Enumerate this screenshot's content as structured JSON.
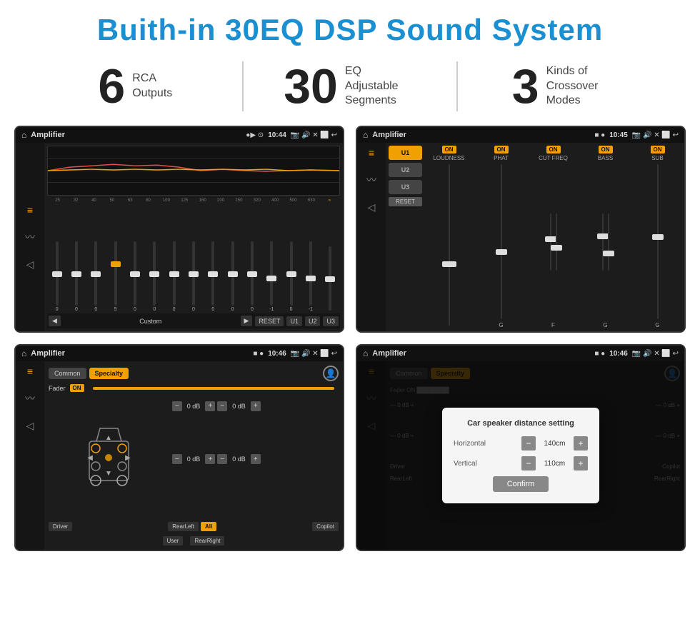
{
  "header": {
    "title": "Buith-in 30EQ DSP Sound System"
  },
  "stats": [
    {
      "number": "6",
      "label": "RCA\nOutputs"
    },
    {
      "number": "30",
      "label": "EQ Adjustable\nSegments"
    },
    {
      "number": "3",
      "label": "Kinds of\nCrossover Modes"
    }
  ],
  "screens": [
    {
      "id": "eq-screen",
      "statusBar": {
        "appName": "Amplifier",
        "time": "10:44"
      }
    },
    {
      "id": "amp-screen",
      "statusBar": {
        "appName": "Amplifier",
        "time": "10:45"
      }
    },
    {
      "id": "crossover-screen",
      "statusBar": {
        "appName": "Amplifier",
        "time": "10:46"
      }
    },
    {
      "id": "dialog-screen",
      "statusBar": {
        "appName": "Amplifier",
        "time": "10:46"
      }
    }
  ],
  "eqScreen": {
    "frequencies": [
      "25",
      "32",
      "40",
      "50",
      "63",
      "80",
      "100",
      "125",
      "160",
      "200",
      "250",
      "320",
      "400",
      "500",
      "630"
    ],
    "values": [
      "0",
      "0",
      "0",
      "5",
      "0",
      "0",
      "0",
      "0",
      "0",
      "0",
      "0",
      "-1",
      "0",
      "-1",
      ""
    ],
    "presets": [
      "Custom",
      "RESET",
      "U1",
      "U2",
      "U3"
    ]
  },
  "ampScreen": {
    "presets": [
      "U1",
      "U2",
      "U3"
    ],
    "controls": [
      {
        "label": "LOUDNESS",
        "on": true
      },
      {
        "label": "PHAT",
        "on": true
      },
      {
        "label": "CUT FREQ",
        "on": true
      },
      {
        "label": "BASS",
        "on": true
      },
      {
        "label": "SUB",
        "on": true
      }
    ],
    "resetLabel": "RESET"
  },
  "crossoverScreen": {
    "tabs": [
      "Common",
      "Specialty"
    ],
    "faderLabel": "Fader",
    "faderOn": "ON",
    "buttons": [
      "Driver",
      "Copilot",
      "RearLeft",
      "All",
      "User",
      "RearRight"
    ],
    "dbValues": [
      "0 dB",
      "0 dB",
      "0 dB",
      "0 dB"
    ]
  },
  "dialogScreen": {
    "title": "Car speaker distance setting",
    "horizontal": {
      "label": "Horizontal",
      "value": "140cm"
    },
    "vertical": {
      "label": "Vertical",
      "value": "110cm"
    },
    "confirmLabel": "Confirm",
    "dbValues": [
      "0 dB",
      "0 dB"
    ]
  }
}
